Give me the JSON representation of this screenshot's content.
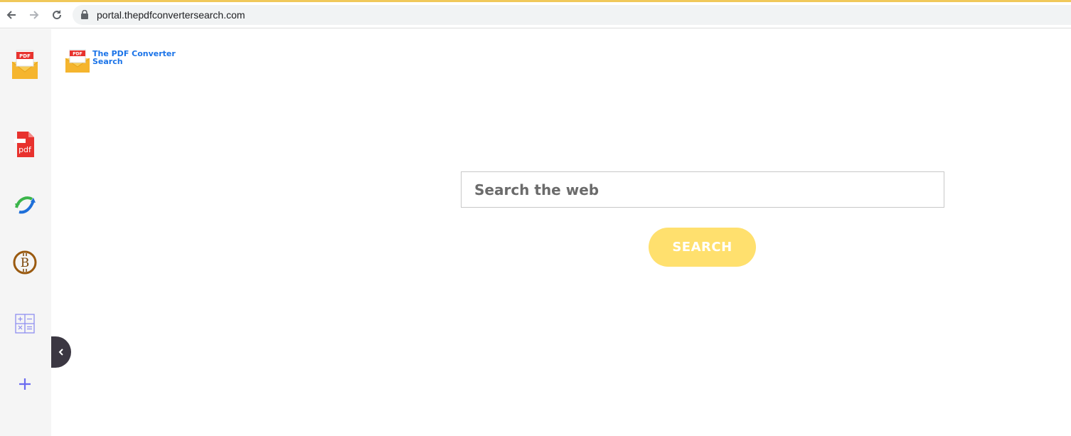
{
  "browser": {
    "url": "portal.thepdfconvertersearch.com",
    "accent_color": "#f0c85a"
  },
  "logo": {
    "line1": "The PDF Converter",
    "line2": "Search",
    "badge": "PDF"
  },
  "sidebar": {
    "items": [
      {
        "name": "pdf-envelope-icon",
        "badge": "PDF"
      },
      {
        "name": "pdf-file-icon",
        "label": "pdf"
      },
      {
        "name": "convert-arrows-icon"
      },
      {
        "name": "bitcoin-icon"
      },
      {
        "name": "calculator-icon"
      },
      {
        "name": "plus-icon"
      }
    ]
  },
  "search": {
    "placeholder": "Search the web",
    "button_label": "SEARCH",
    "button_color": "#ffe06e"
  }
}
